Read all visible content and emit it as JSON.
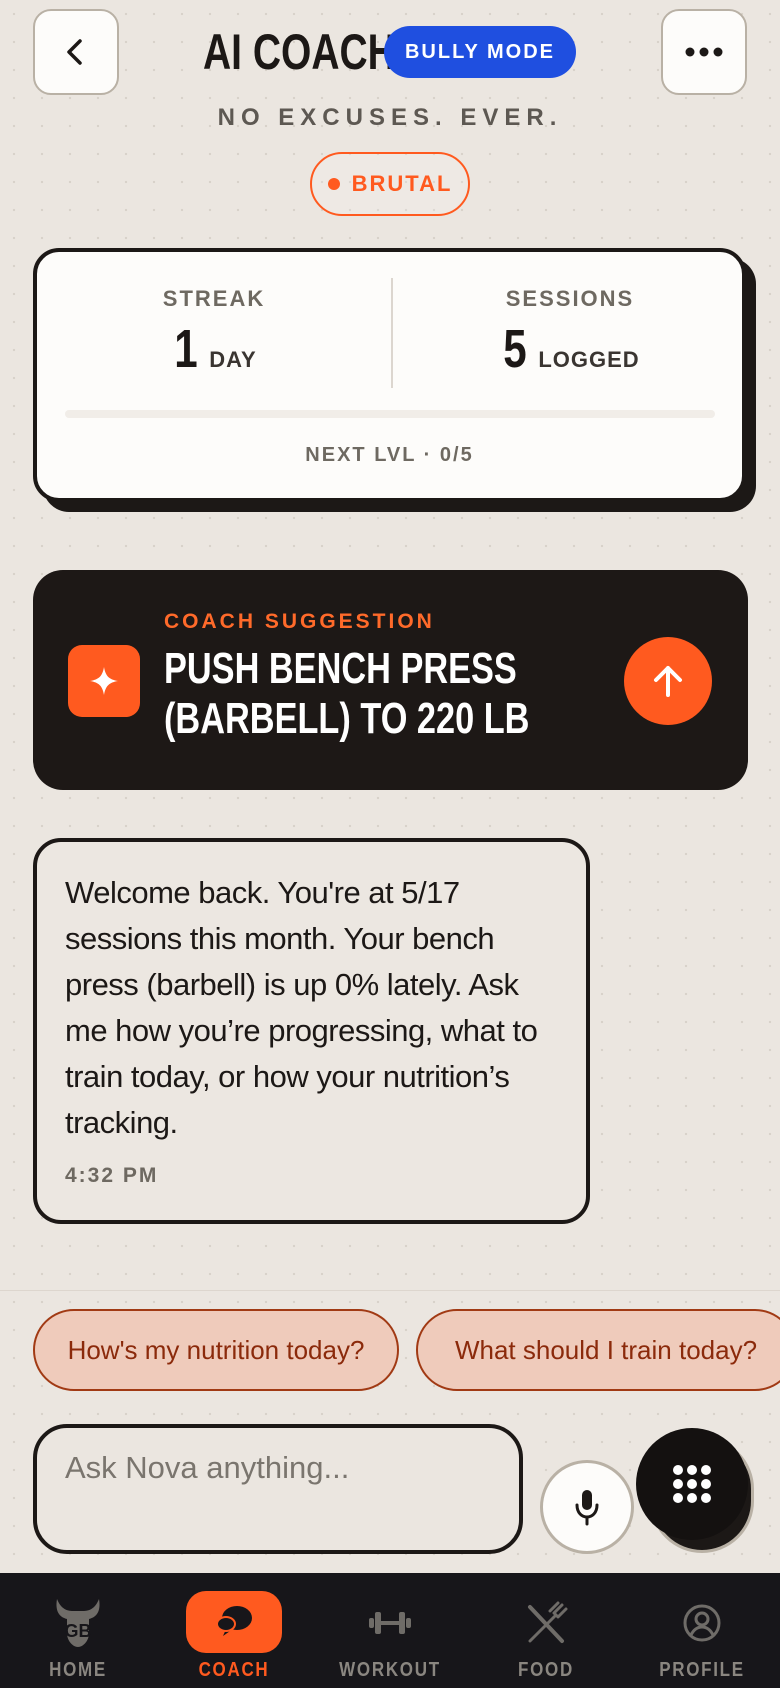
{
  "header": {
    "title": "AI COACH",
    "mode_badge": "BULLY MODE",
    "tagline": "NO EXCUSES. EVER.",
    "intensity_badge": "BRUTAL"
  },
  "stats": {
    "streak_label": "STREAK",
    "streak_value": "1",
    "streak_unit": "DAY",
    "sessions_label": "SESSIONS",
    "sessions_value": "5",
    "sessions_unit": "LOGGED",
    "next_level": "NEXT LVL · 0/5",
    "progress_fraction": 0
  },
  "suggestion": {
    "label": "COACH SUGGESTION",
    "line1": "PUSH BENCH PRESS",
    "line2": "(BARBELL) TO 220 LB",
    "icon": "sparkle-icon",
    "action_icon": "arrow-up-icon"
  },
  "message": {
    "text": "Welcome back. You're at 5/17 sessions this month. Your bench press (barbell) is up 0% lately. Ask me how you’re progressing, what to train today, or how your nutrition’s tracking.",
    "time": "4:32 PM"
  },
  "quick_replies": [
    "How's my nutrition today?",
    "What should I train today?"
  ],
  "composer": {
    "placeholder": "Ask Nova anything..."
  },
  "nav": {
    "items": [
      {
        "label": "HOME",
        "icon": "bull-logo-icon"
      },
      {
        "label": "COACH",
        "icon": "chat-bubbles-icon",
        "active": true
      },
      {
        "label": "WORKOUT",
        "icon": "dumbbell-icon"
      },
      {
        "label": "FOOD",
        "icon": "fork-knife-icon"
      },
      {
        "label": "PROFILE",
        "icon": "user-circle-icon"
      }
    ]
  },
  "colors": {
    "accent": "#ff5a1f",
    "badge_blue": "#1f4fe0",
    "dark": "#1c1816",
    "background": "#ebe6e0"
  }
}
